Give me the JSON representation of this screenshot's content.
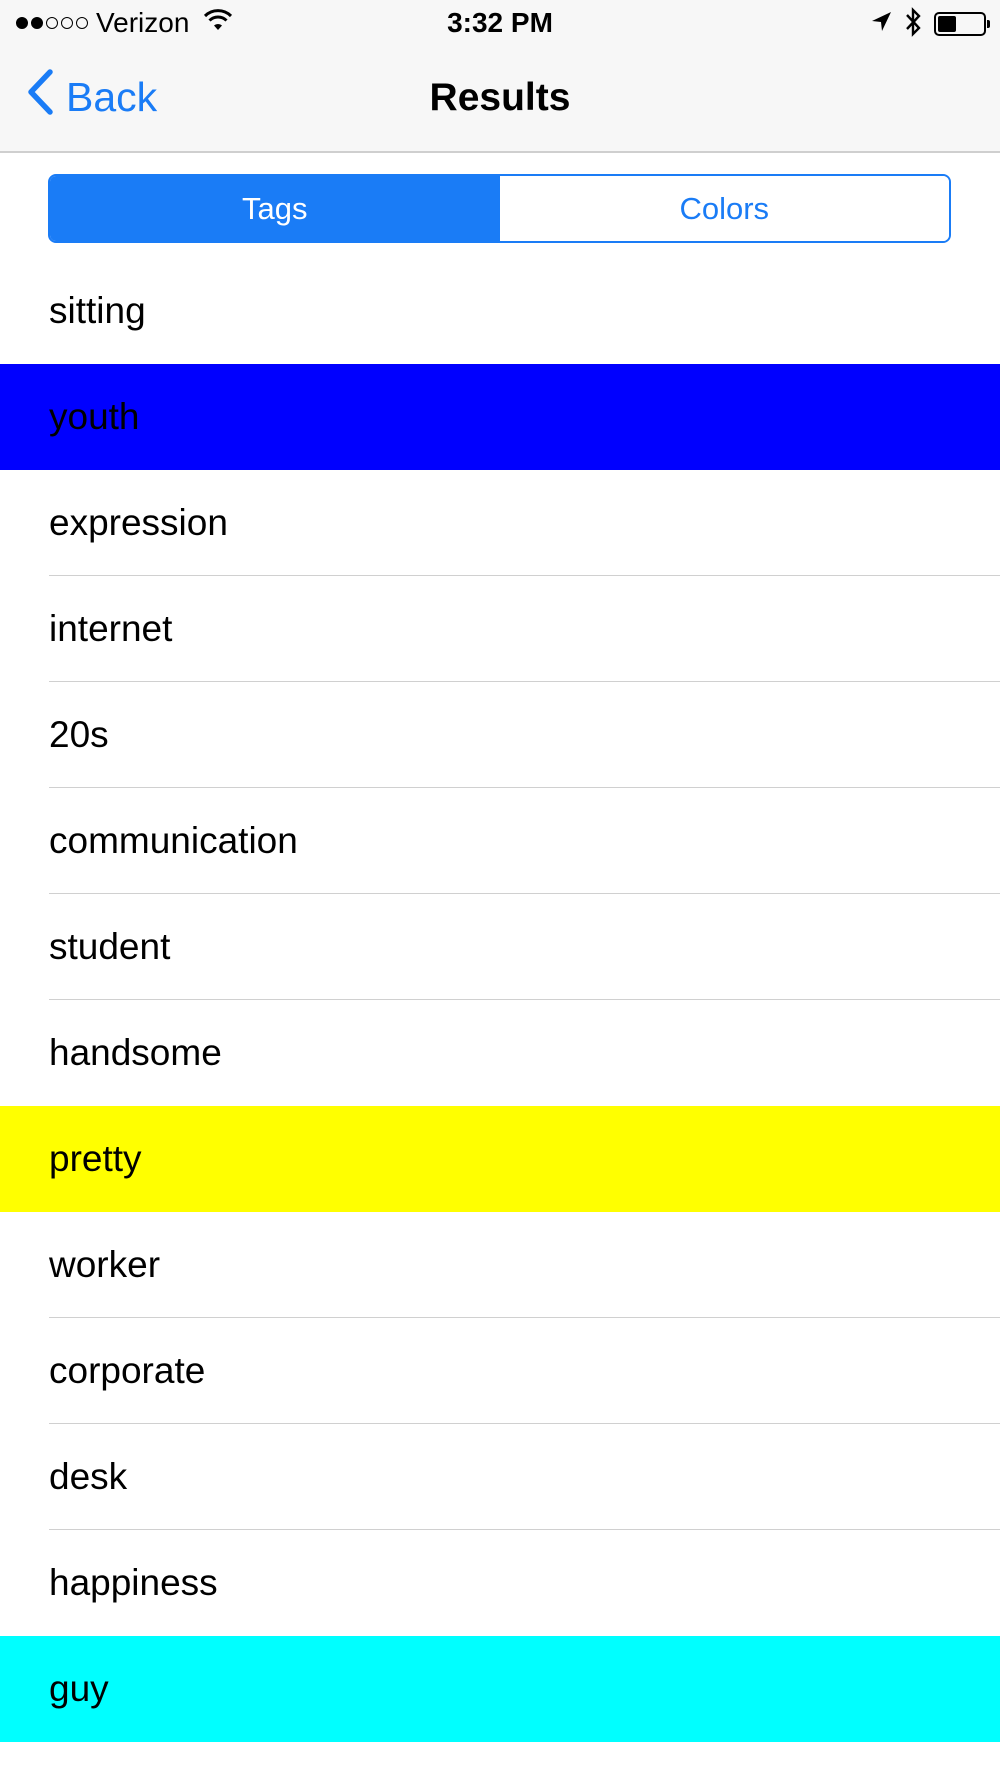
{
  "status_bar": {
    "carrier": "Verizon",
    "signal_bars_filled": 2,
    "signal_bars_total": 5,
    "time": "3:32 PM",
    "battery_level": 0.4,
    "icons": [
      "wifi-icon",
      "location-arrow-icon",
      "bluetooth-icon",
      "battery-icon"
    ]
  },
  "nav": {
    "back_label": "Back",
    "title": "Results"
  },
  "segmented_control": {
    "segments": [
      {
        "label": "Tags",
        "selected": true
      },
      {
        "label": "Colors",
        "selected": false
      }
    ]
  },
  "colors": {
    "accent": "#1a7cf6",
    "highlight_blue": "#0000ff",
    "highlight_yellow": "#ffff00",
    "highlight_cyan": "#00ffff"
  },
  "tags": [
    {
      "label": "sitting",
      "highlight": null
    },
    {
      "label": "youth",
      "highlight": "#0000ff"
    },
    {
      "label": "expression",
      "highlight": null
    },
    {
      "label": "internet",
      "highlight": null
    },
    {
      "label": "20s",
      "highlight": null
    },
    {
      "label": "communication",
      "highlight": null
    },
    {
      "label": "student",
      "highlight": null
    },
    {
      "label": "handsome",
      "highlight": null
    },
    {
      "label": "pretty",
      "highlight": "#ffff00"
    },
    {
      "label": "worker",
      "highlight": null
    },
    {
      "label": "corporate",
      "highlight": null
    },
    {
      "label": "desk",
      "highlight": null
    },
    {
      "label": "happiness",
      "highlight": null
    },
    {
      "label": "guy",
      "highlight": "#00ffff"
    }
  ]
}
